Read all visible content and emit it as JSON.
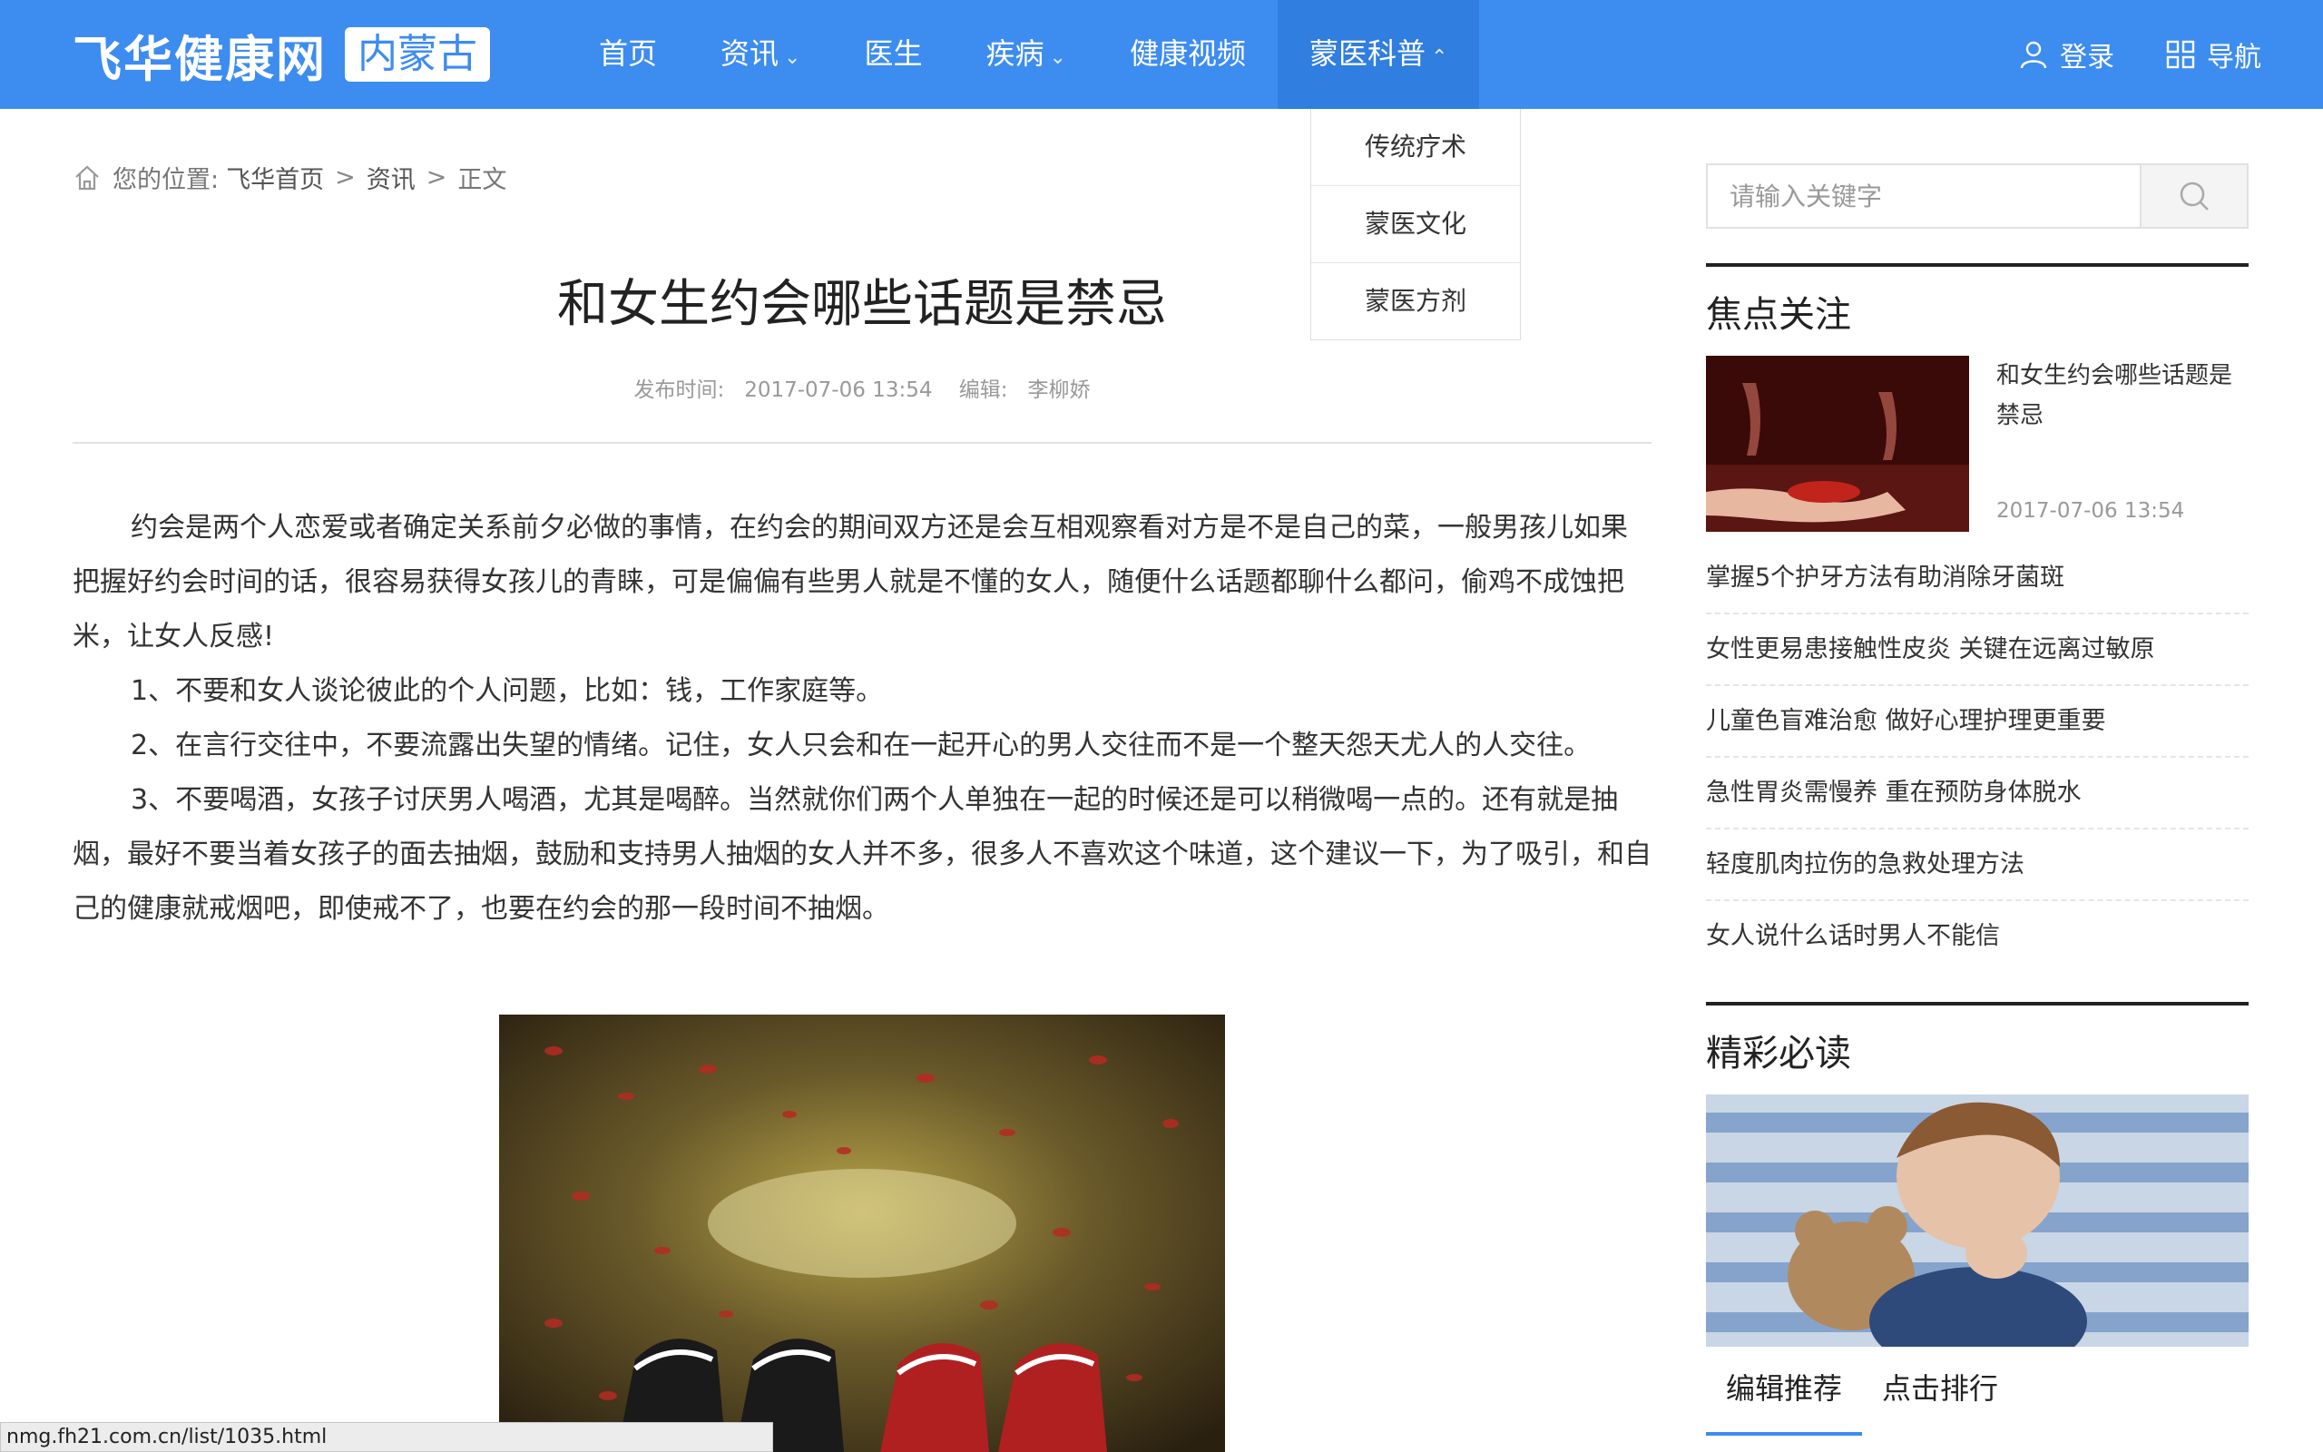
{
  "header": {
    "logo_text": "飞华健康网",
    "region_badge": "内蒙古",
    "nav": [
      {
        "label": "首页"
      },
      {
        "label": "资讯"
      },
      {
        "label": "医生"
      },
      {
        "label": "疾病"
      },
      {
        "label": "健康视频"
      },
      {
        "label": "蒙医科普"
      }
    ],
    "login_label": "登录",
    "navigation_label": "导航",
    "accent_color": "#3d8cf0"
  },
  "dropdown": {
    "items": [
      {
        "label": "传统疗术"
      },
      {
        "label": "蒙医文化"
      },
      {
        "label": "蒙医方剂"
      }
    ]
  },
  "breadcrumb": {
    "prefix": "您的位置:",
    "items": [
      {
        "label": "飞华首页"
      },
      {
        "label": "资讯"
      },
      {
        "label": "正文"
      }
    ],
    "separator": ">"
  },
  "article": {
    "title": "和女生约会哪些话题是禁忌",
    "publish_label": "发布时间:",
    "publish_time": "2017-07-06 13:54",
    "editor_label": "编辑:",
    "editor": "李柳娇",
    "paragraphs": [
      "约会是两个人恋爱或者确定关系前夕必做的事情，在约会的期间双方还是会互相观察看对方是不是自己的菜，一般男孩儿如果把握好约会时间的话，很容易获得女孩儿的青睐，可是偏偏有些男人就是不懂的女人，随便什么话题都聊什么都问，偷鸡不成蚀把米，让女人反感!",
      "1、不要和女人谈论彼此的个人问题，比如：钱，工作家庭等。",
      "2、在言行交往中，不要流露出失望的情绪。记住，女人只会和在一起开心的男人交往而不是一个整天怨天尤人的人交往。",
      "3、不要喝酒，女孩子讨厌男人喝酒，尤其是喝醉。当然就你们两个人单独在一起的时候还是可以稍微喝一点的。还有就是抽烟，最好不要当着女孩子的面去抽烟，鼓励和支持男人抽烟的女人并不多，很多人不喜欢这个味道，这个建议一下，为了吸引，和自己的健康就戒烟吧，即使戒不了，也要在约会的那一段时间不抽烟。"
    ]
  },
  "sidebar": {
    "search_placeholder": "请输入关键字",
    "focus_title": "焦点关注",
    "focus_card": {
      "title": "和女生约会哪些话题是禁忌",
      "date": "2017-07-06 13:54"
    },
    "news": [
      {
        "title": "掌握5个护牙方法有助消除牙菌斑"
      },
      {
        "title": "女性更易患接触性皮炎 关键在远离过敏原"
      },
      {
        "title": "儿童色盲难治愈 做好心理护理更重要"
      },
      {
        "title": "急性胃炎需慢养 重在预防身体脱水"
      },
      {
        "title": "轻度肌肉拉伤的急救处理方法"
      },
      {
        "title": "女人说什么话时男人不能信"
      }
    ],
    "featured_title": "精彩必读",
    "tabs": [
      {
        "label": "编辑推荐"
      },
      {
        "label": "点击排行"
      }
    ]
  },
  "status_bar": {
    "url": "nmg.fh21.com.cn/list/1035.html"
  }
}
